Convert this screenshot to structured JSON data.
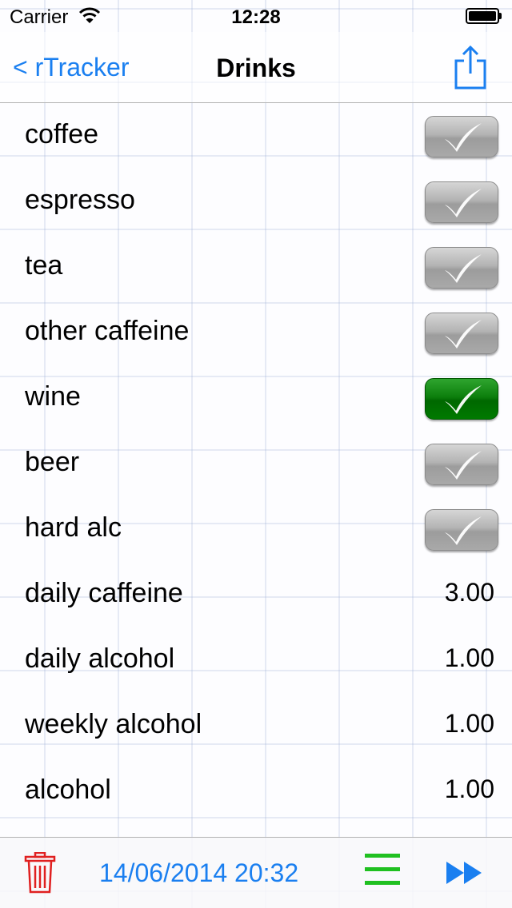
{
  "status_bar": {
    "carrier": "Carrier",
    "time": "12:28"
  },
  "nav": {
    "back_label": "< rTracker",
    "title": "Drinks",
    "share_icon": "share-icon"
  },
  "rows": [
    {
      "label": "coffee",
      "type": "checkbox",
      "checked": false
    },
    {
      "label": "espresso",
      "type": "checkbox",
      "checked": false
    },
    {
      "label": "tea",
      "type": "checkbox",
      "checked": false
    },
    {
      "label": "other caffeine",
      "type": "checkbox",
      "checked": false
    },
    {
      "label": "wine",
      "type": "checkbox",
      "checked": true
    },
    {
      "label": "beer",
      "type": "checkbox",
      "checked": false
    },
    {
      "label": "hard alc",
      "type": "checkbox",
      "checked": false
    },
    {
      "label": "daily caffeine",
      "type": "value",
      "value": "3.00"
    },
    {
      "label": "daily alcohol",
      "type": "value",
      "value": "1.00"
    },
    {
      "label": "weekly alcohol",
      "type": "value",
      "value": "1.00"
    },
    {
      "label": "alcohol",
      "type": "value",
      "value": "1.00"
    }
  ],
  "toolbar": {
    "date": "14/06/2014 20:32",
    "trash_icon": "trash-icon",
    "menu_icon": "menu-icon",
    "forward_icon": "fast-forward-icon"
  },
  "colors": {
    "accent": "#1a7ff0",
    "checked": "#0d7f0d",
    "unchecked": "#a9a9a9",
    "trash": "#e02020",
    "menu": "#20c020"
  }
}
